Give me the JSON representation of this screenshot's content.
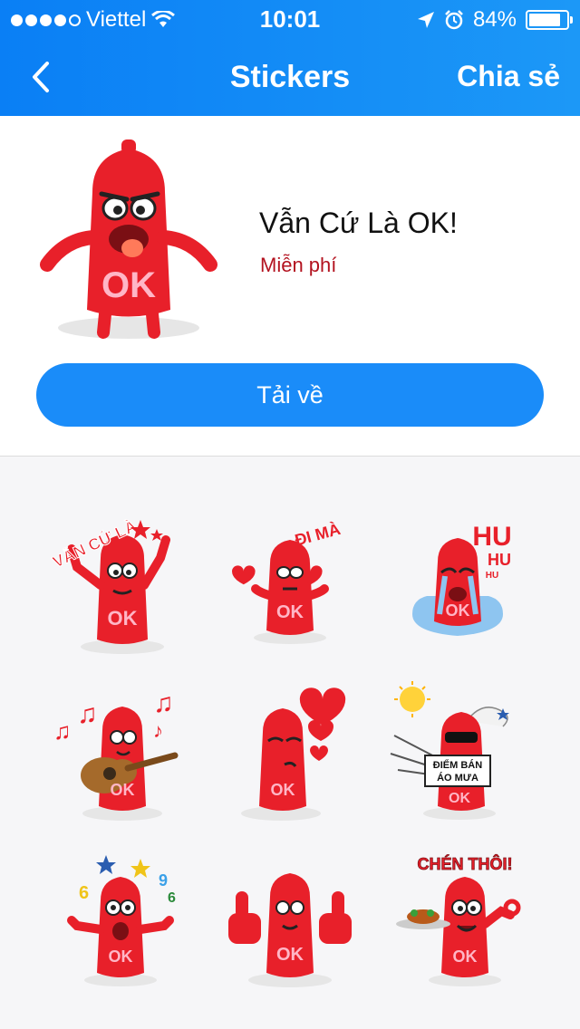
{
  "status_bar": {
    "carrier": "Viettel",
    "time": "10:01",
    "battery_percent": "84%",
    "battery_level": 0.84
  },
  "nav": {
    "title": "Stickers",
    "share_label": "Chia sẻ",
    "back_icon": "chevron-left-icon"
  },
  "pack": {
    "title": "Vẫn Cứ Là OK!",
    "price": "Miễn phí",
    "download_label": "Tải về",
    "logo_text": "OK"
  },
  "stickers": [
    {
      "name": "van-cu-la",
      "caption": "VẪN CỨ LÀ",
      "badge": "OK"
    },
    {
      "name": "di-ma",
      "caption": "ĐI MÀ",
      "badge": "OK"
    },
    {
      "name": "hu-hu",
      "caption": "HU",
      "caption2": "HU",
      "caption3": "HU",
      "badge": "OK"
    },
    {
      "name": "guitar",
      "caption": "",
      "badge": "OK"
    },
    {
      "name": "hearts",
      "caption": "",
      "badge": "OK"
    },
    {
      "name": "diem-ban-ao-mua",
      "caption": "ĐIỂM BÁN",
      "caption2": "ÁO MƯA",
      "badge": "OK"
    },
    {
      "name": "excited",
      "caption": "",
      "badge": "OK"
    },
    {
      "name": "thumbs-up",
      "caption": "",
      "badge": "OK"
    },
    {
      "name": "chen-thoi",
      "caption": "CHÉN THÔI!",
      "badge": "OK"
    }
  ],
  "colors": {
    "header_start": "#0a7ff5",
    "header_end": "#1c98f7",
    "download_button": "#1a8cf9",
    "price_text": "#b3121f",
    "sticker_red": "#e8202a",
    "grid_bg": "#f6f6f8"
  }
}
